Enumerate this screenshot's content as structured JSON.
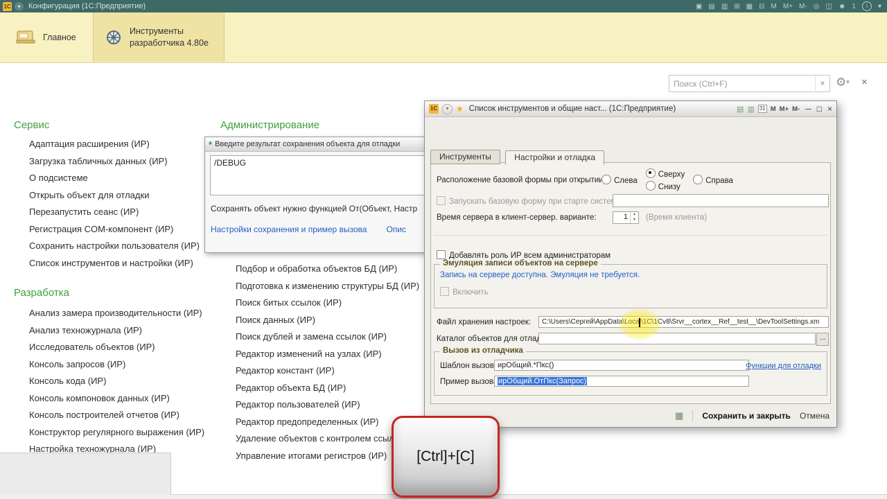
{
  "window": {
    "title": "Конфигурация  (1С:Предприятие)"
  },
  "ribbon": {
    "tabs": [
      {
        "label": "Главное"
      },
      {
        "label": "Инструменты разработчика 4.80e"
      }
    ]
  },
  "search": {
    "placeholder": "Поиск (Ctrl+F)"
  },
  "colors": {
    "titlebar_bg": "#3d6966",
    "ribbon_bg": "#f8f1c2",
    "ribbon_tab_active_bg": "#efe3a4",
    "section_header_green": "#3fa03f",
    "link_blue": "#1f5fc4",
    "selection_blue": "#3b74d9",
    "key_overlay_red": "#c4261d",
    "annotation_yellow": "#ffe800"
  },
  "sections": {
    "service": {
      "title": "Сервис",
      "items": [
        "Адаптация расширения (ИР)",
        "Загрузка табличных данных (ИР)",
        "О подсистеме",
        "Открыть объект для отладки",
        "Перезапустить сеанс (ИР)",
        "Регистрация COM-компонент (ИР)",
        "Сохранить настройки пользователя (ИР)",
        "Список инструментов и настройки (ИР)"
      ]
    },
    "development": {
      "title": "Разработка",
      "items": [
        "Анализ замера производительности (ИР)",
        "Анализ техножурнала (ИР)",
        "Исследователь объектов (ИР)",
        "Консоль запросов (ИР)",
        "Консоль кода (ИР)",
        "Консоль компоновок данных (ИР)",
        "Консоль построителей отчетов (ИР)",
        "Конструктор регулярного выражения (ИР)",
        "Настройка техножурнала (ИР)"
      ]
    },
    "administration": {
      "title": "Администрирование",
      "items": [
        "Подбор и обработка объектов БД (ИР)",
        "Подготовка к изменению структуры БД (ИР)",
        "Поиск битых ссылок (ИР)",
        "Поиск данных (ИР)",
        "Поиск дублей и замена ссылок (ИР)",
        "Редактор изменений на узлах (ИР)",
        "Редактор констант (ИР)",
        "Редактор объекта БД (ИР)",
        "Редактор пользователей (ИР)",
        "Редактор предопределенных (ИР)",
        "Удаление объектов с контролем ссылок",
        "Управление итогами регистров (ИР)"
      ]
    }
  },
  "tooltip_dialog": {
    "title": "Введите результат сохранения объекта для отладки",
    "input_value": "/DEBUG",
    "hint": "Сохранять объект нужно функцией От(Объект, Настр",
    "link_settings": "Настройки сохранения и пример вызова",
    "link_more": "Опис"
  },
  "settings_dialog": {
    "title": "Список инструментов и общие наст...  (1С:Предприятие)",
    "tabs": [
      {
        "label": "Инструменты"
      },
      {
        "label": "Настройки и отладка"
      }
    ],
    "placement": {
      "label": "Расположение базовой формы при открытии:",
      "options": [
        "Слева",
        "Сверху",
        "Снизу",
        "Справа"
      ],
      "selected": "Сверху"
    },
    "autostart": {
      "label": "Запускать базовую форму при старте системы",
      "value": ""
    },
    "server_time": {
      "label": "Время сервера в клиент-сервер. варианте:",
      "value": "1",
      "hint": "(Время клиента)"
    },
    "add_role": {
      "label": "Добавлять роль ИР всем администраторам"
    },
    "emulation": {
      "group_label": "Эмуляция записи объектов на сервере",
      "status": "Запись на сервере доступна. Эмуляция не требуется.",
      "enable_label": "Включить"
    },
    "settings_file": {
      "label": "Файл хранения настроек:",
      "value": "C:\\Users\\Сергей\\AppData\\Local\\1C\\1Cv8\\Srvr__cortex__Ref__test__\\DevToolSettings.xm"
    },
    "debug_catalog": {
      "label": "Каталог объектов для отладки",
      "value": ""
    },
    "debugger_call": {
      "group_label": "Вызов из отладчика",
      "template_label": "Шаблон вызова:",
      "template_value": "ирОбщий.*Пкс()",
      "functions_link": "Функции для отладки",
      "example_label": "Пример вызова:",
      "example_value": "ирОбщий.ОтПкс(Запрос)"
    },
    "footer": {
      "save": "Сохранить и закрыть",
      "cancel": "Отмена"
    }
  },
  "key_overlay": {
    "text": "[Ctrl]+[C]"
  },
  "icons": {
    "app_logo": "1С",
    "menu_chevron": "▾",
    "tb_save": "▣",
    "tb_print": "▤",
    "tb_preview": "▥",
    "tb_link": "⊞",
    "tb_calendar": "▦",
    "tb_calculator": "⊟",
    "tb_m": "M",
    "tb_m_plus": "M+",
    "tb_m_minus": "M-",
    "tb_zoom": "◎",
    "tb_panels": "◫",
    "tb_user": "☻",
    "tb_user_count": "1",
    "tb_help": "i",
    "tb_help_chevron": "▾",
    "search_clear": "×",
    "gear": "⚙",
    "gear_chevron": "▾",
    "workspace_close": "×",
    "tooltip_marker": "*",
    "dlg_logo": "1С",
    "dlg_star": "★",
    "dlg_doc1": "▤",
    "dlg_doc2": "▥",
    "dlg_calendar": "31",
    "dlg_m": "M",
    "dlg_m_plus": "M+",
    "dlg_m_minus": "M-",
    "dlg_minimize": "─",
    "dlg_maximize": "□",
    "dlg_close": "×",
    "spin_up": "▲",
    "spin_down": "▼",
    "ellipsis": "...",
    "footer_icon": "▦"
  }
}
